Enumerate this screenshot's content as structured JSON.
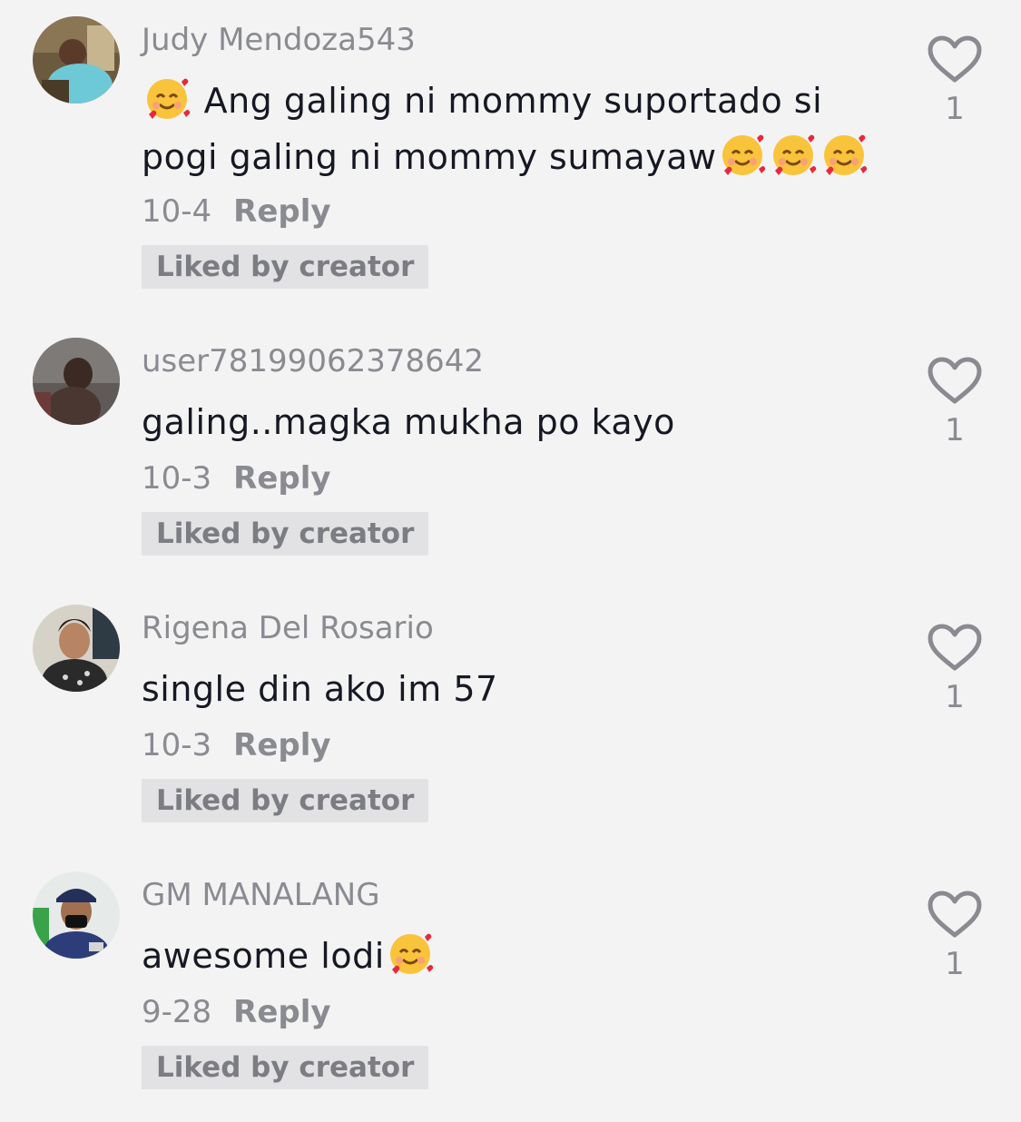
{
  "comments": [
    {
      "username": "Judy Mendoza543",
      "text_prefix_emoji": "smiling-face-with-hearts-icon",
      "text": "Ang galing ni mommy suportado si pogi galing ni mommy sumayaw",
      "text_suffix_emojis": 3,
      "date": "10-4",
      "reply_label": "Reply",
      "badge": "Liked by creator",
      "likes": "1"
    },
    {
      "username": "user78199062378642",
      "text": "galing..magka mukha po kayo",
      "date": "10-3",
      "reply_label": "Reply",
      "badge": "Liked by creator",
      "likes": "1"
    },
    {
      "username": "Rigena Del Rosario",
      "text": "single din ako im 57",
      "date": "10-3",
      "reply_label": "Reply",
      "badge": "Liked by creator",
      "likes": "1"
    },
    {
      "username": "GM MANALANG",
      "text": "awesome lodi",
      "text_suffix_emojis": 1,
      "date": "9-28",
      "reply_label": "Reply",
      "badge": "Liked by creator",
      "likes": "1"
    }
  ],
  "icons": {
    "like": "heart-outline-icon",
    "emoji": "smiling-face-with-hearts-icon"
  },
  "colors": {
    "background": "#f3f3f3",
    "username": "#8a8b91",
    "text": "#161823",
    "badge_bg": "#e2e2e4",
    "heart_stroke": "#8a8b91"
  }
}
